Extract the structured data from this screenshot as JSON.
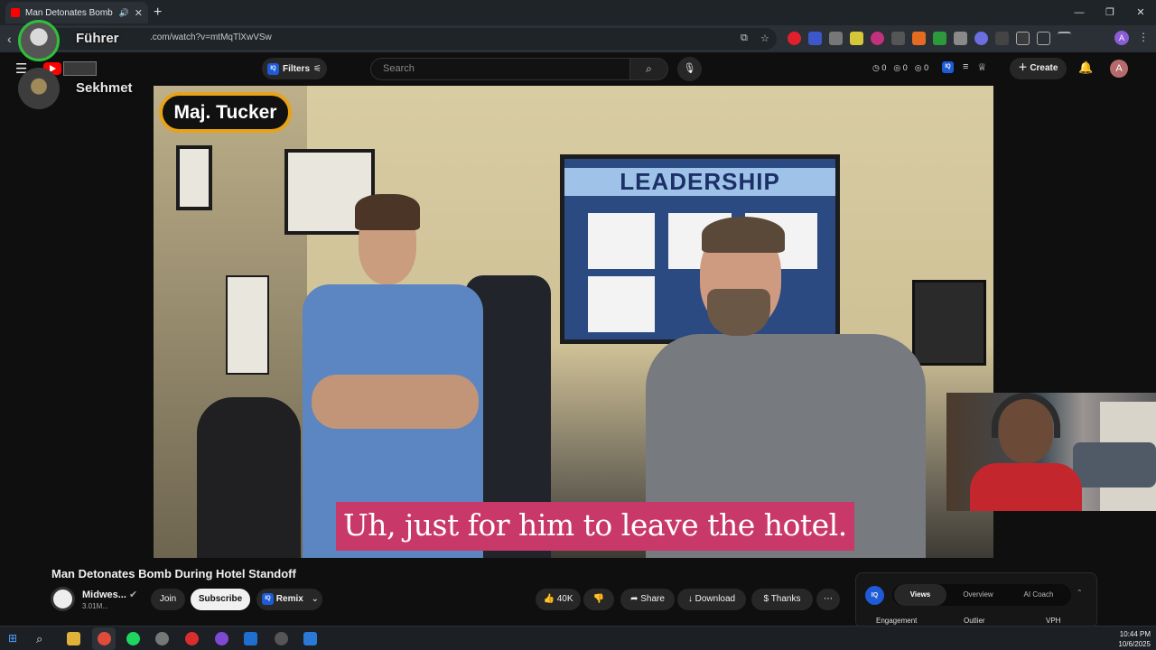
{
  "browser": {
    "tab_title": "Man Detonates Bomb During Hotel Standoff",
    "url": ".com/watch?v=mtMqTlXwVSw",
    "profile_initial": "A"
  },
  "overlay": {
    "user1": "Führer",
    "user2": "Sekhmet"
  },
  "youtube_header": {
    "filters_label": "Filters",
    "search_placeholder": "Search",
    "stat1": "0",
    "stat2": "0",
    "stat3": "0",
    "create_label": "Create",
    "avatar_initial": "A"
  },
  "video": {
    "name_tag": "Maj. Tucker",
    "caption": "Uh, just for him to leave the hotel.",
    "board_title": "LEADERSHIP"
  },
  "below_video": {
    "title": "Man Detonates Bomb During Hotel Standoff",
    "channel_name": "Midwes...",
    "subscribers": "3.01M...",
    "join_label": "Join",
    "subscribe_label": "Subscribe",
    "remix_label": "Remix",
    "likes": "40K",
    "share_label": "Share",
    "download_label": "Download",
    "thanks_label": "Thanks"
  },
  "stats_panel": {
    "tabs": [
      "Views",
      "Overview",
      "AI Coach"
    ],
    "active_tab": "Views",
    "columns": [
      "Engagement",
      "Outlier",
      "VPH"
    ]
  },
  "taskbar": {
    "time": "10:44 PM",
    "date": "10/6/2025"
  },
  "colors": {
    "caption_bg": "#c8396a",
    "nameplate_border": "#e8a21a",
    "youtube_red": "#ff0000"
  }
}
